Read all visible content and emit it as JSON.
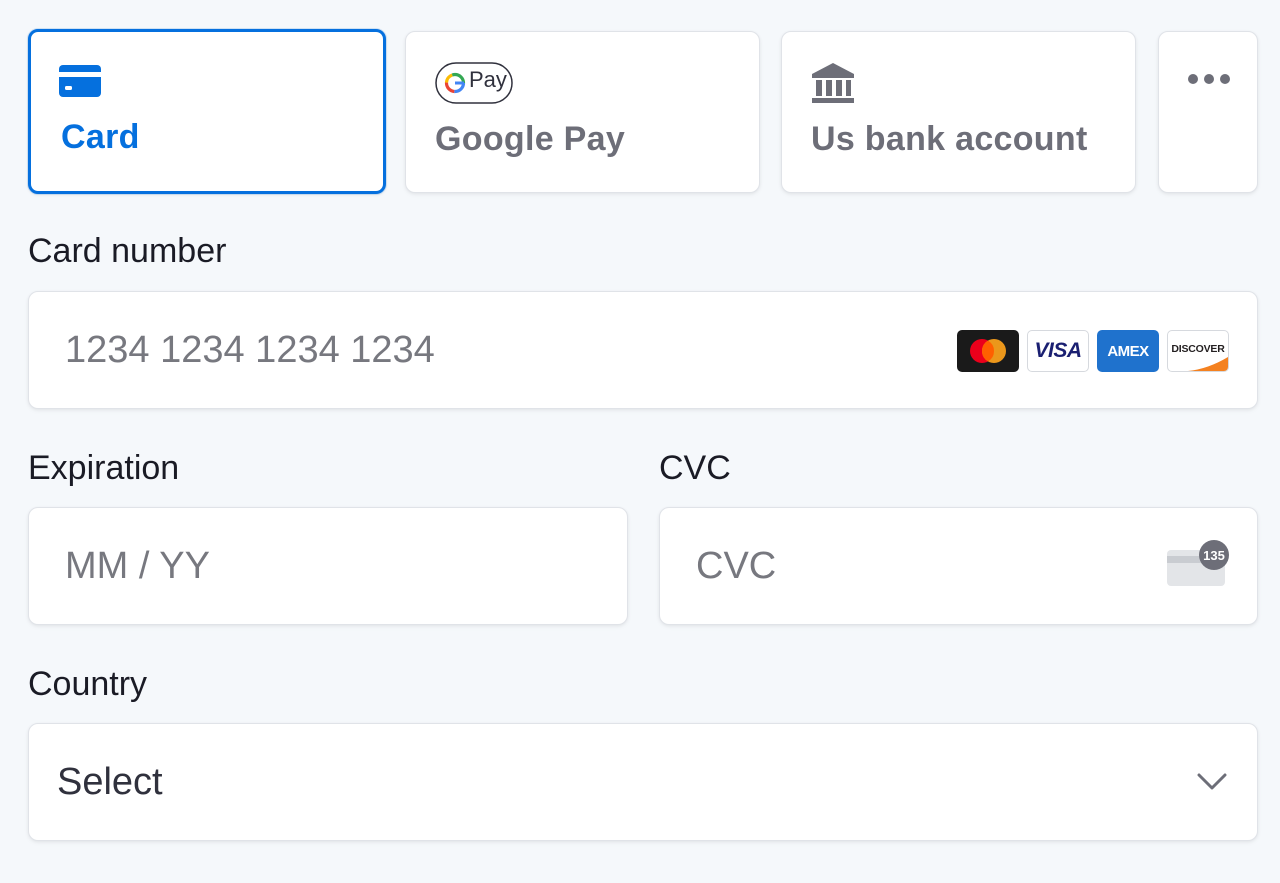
{
  "payment_tabs": [
    {
      "label": "Card",
      "icon": "card-icon",
      "active": true
    },
    {
      "label": "Google Pay",
      "icon": "google-pay-icon",
      "active": false
    },
    {
      "label": "Us bank account",
      "icon": "bank-icon",
      "active": false
    }
  ],
  "google_pay_badge": "Pay",
  "more_icon": "more-dots-icon",
  "card_number": {
    "label": "Card number",
    "placeholder": "1234 1234 1234 1234",
    "value": ""
  },
  "card_brands": [
    {
      "name": "mastercard-logo"
    },
    {
      "name": "visa-logo",
      "text": "VISA"
    },
    {
      "name": "amex-logo",
      "text": "AMEX"
    },
    {
      "name": "discover-logo",
      "text": "DISCOVER"
    }
  ],
  "expiration": {
    "label": "Expiration",
    "placeholder": "MM / YY",
    "value": ""
  },
  "cvc": {
    "label": "CVC",
    "placeholder": "CVC",
    "value": "",
    "icon_badge": "135"
  },
  "country": {
    "label": "Country",
    "selected": "Select"
  },
  "colors": {
    "accent": "#0570de",
    "text": "#30313d",
    "muted": "#6d6e78",
    "border": "#e0e3e8",
    "background": "#f5f8fb"
  }
}
